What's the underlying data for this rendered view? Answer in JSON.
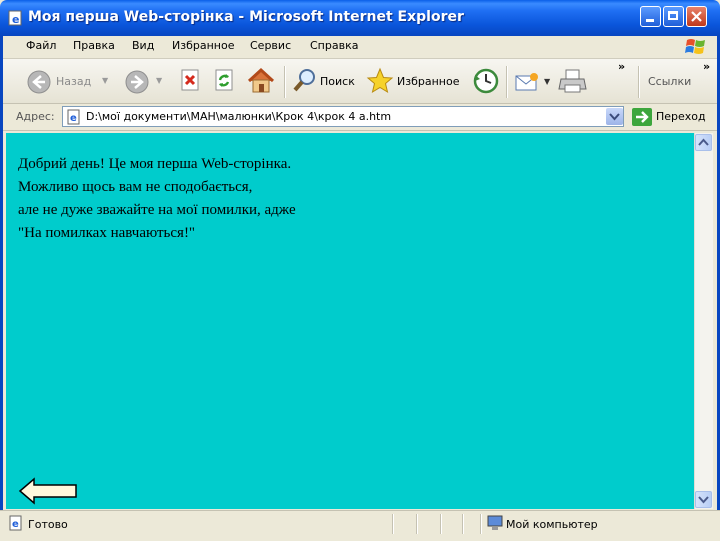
{
  "window": {
    "title": "Моя перша Web-сторінка - Microsoft Internet Explorer"
  },
  "menu": {
    "items": [
      "Файл",
      "Правка",
      "Вид",
      "Избранное",
      "Сервис",
      "Справка"
    ]
  },
  "toolbar": {
    "back_label": "Назад",
    "search_label": "Поиск",
    "favorites_label": "Избранное",
    "links_label": "Ссылки",
    "overflow": "»"
  },
  "address": {
    "label": "Адрес:",
    "value": "D:\\мої документи\\МАН\\малюнки\\Крок 4\\крок 4 a.htm",
    "go_label": "Переход"
  },
  "page": {
    "lines": [
      "Добрий день! Це моя перша Web-сторінка.",
      "Можливо щось вам не сподобається,",
      "але не дуже зважайте на мої помилки, адже",
      "\"На помилках навчаються!\""
    ],
    "background_color": "#00CCCC"
  },
  "status": {
    "text": "Готово",
    "zone": "Мой компьютер"
  }
}
